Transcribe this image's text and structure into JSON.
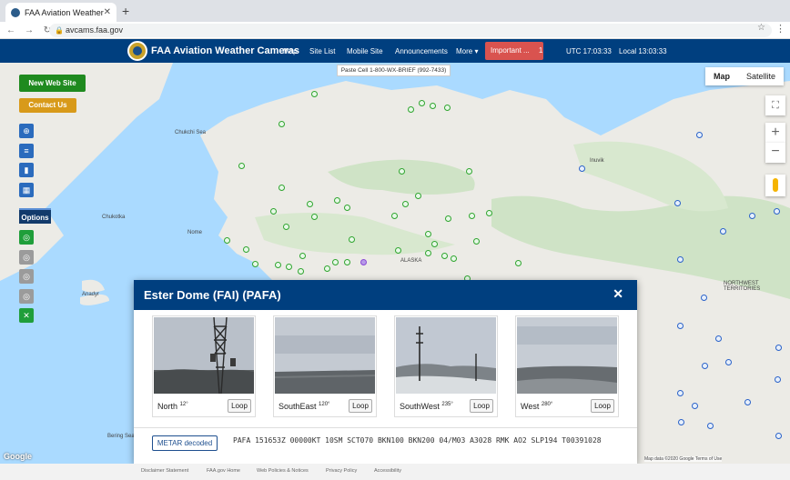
{
  "browser": {
    "tab_title": "FAA Aviation Weather Cameras",
    "url": "avcams.faa.gov"
  },
  "header": {
    "title": "FAA Aviation Weather Cameras",
    "nav": [
      "Map",
      "Site List",
      "Mobile Site",
      "Announcements",
      "More ▾"
    ],
    "important_label": "Important ...",
    "important_count": "1",
    "utc_time": "UTC 17:03:33",
    "local_time": "Local 13:03:33"
  },
  "map": {
    "new_site_label": "New Web Site",
    "contact_label": "Contact Us",
    "options_label": "Options",
    "dropdown_label": "Paste Cell 1-800-WX-BRIEF (992-7433)",
    "map_type": [
      "Map",
      "Satellite"
    ],
    "labels": [
      "Chukchi Sea",
      "Chukotka",
      "Nome",
      "Anadyr",
      "ALASKA",
      "Bering Sea",
      "NORTHWEST TERRITORIES",
      "Inuvik"
    ],
    "attribution": "Map data ©2020 Google  Terms of Use",
    "google": "Google"
  },
  "modal": {
    "title": "Ester Dome (FAI) (PAFA)",
    "cameras": [
      {
        "direction": "North",
        "deg": "12°",
        "loop": "Loop"
      },
      {
        "direction": "SouthEast",
        "deg": "120°",
        "loop": "Loop"
      },
      {
        "direction": "SouthWest",
        "deg": "235°",
        "loop": "Loop"
      },
      {
        "direction": "West",
        "deg": "280°",
        "loop": "Loop"
      }
    ],
    "metar_button": "METAR decoded",
    "metar_text": "PAFA 151653Z 00000KT 10SM SCT070 BKN100 BKN200 04/M03 A3028 RMK AO2 SLP194 T00391028"
  },
  "footer": {
    "links": [
      "Disclaimer Statement",
      "FAA.gov Home",
      "Web Policies & Notices",
      "Privacy Policy",
      "Accessibility"
    ]
  },
  "colors": {
    "header_bg": "#003f7f",
    "new_site": "#1f8a1f",
    "contact": "#d89a1a",
    "important": "#d9534f",
    "dot_green": "#2fa52f",
    "dot_blue": "#2a62c9"
  }
}
